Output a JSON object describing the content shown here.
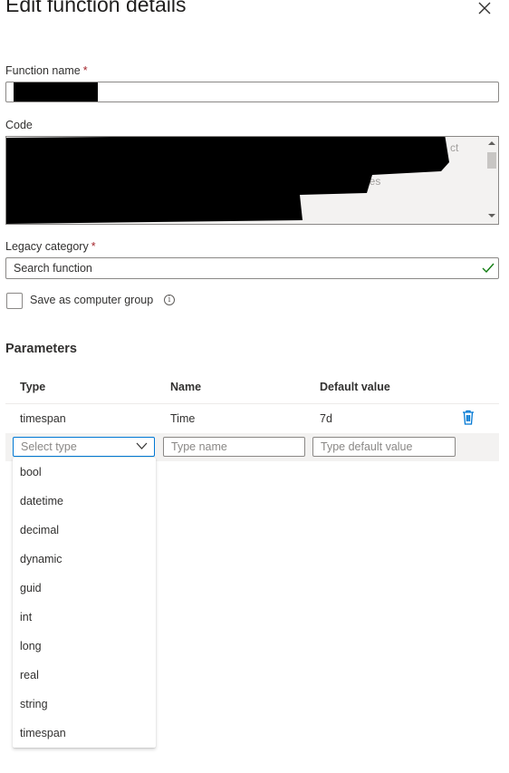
{
  "panel": {
    "title": "Edit function details"
  },
  "function_name": {
    "label": "Function name",
    "required_mark": "*",
    "value": "<redacted>"
  },
  "code": {
    "label": "Code",
    "visible_fragments": [
      "ct",
      "les"
    ]
  },
  "legacy_category": {
    "label": "Legacy category",
    "required_mark": "*",
    "value": "Search function",
    "valid_icon": "checkmark-icon"
  },
  "computer_group": {
    "label": "Save as computer group",
    "checked": false,
    "info_icon": "info-icon",
    "info_glyph": "i"
  },
  "parameters": {
    "title": "Parameters",
    "columns": [
      "Type",
      "Name",
      "Default value"
    ],
    "rows": [
      {
        "type": "timespan",
        "name": "Time",
        "default_value": "7d"
      }
    ],
    "delete_icon": "trash-icon",
    "new_row": {
      "type_placeholder": "Select type",
      "name_placeholder": "Type name",
      "default_placeholder": "Type default value"
    },
    "type_options": [
      "bool",
      "datetime",
      "decimal",
      "dynamic",
      "guid",
      "int",
      "long",
      "real",
      "string",
      "timespan"
    ]
  },
  "colors": {
    "accent": "#0078d4",
    "required": "#a4262c",
    "success": "#107c10"
  }
}
